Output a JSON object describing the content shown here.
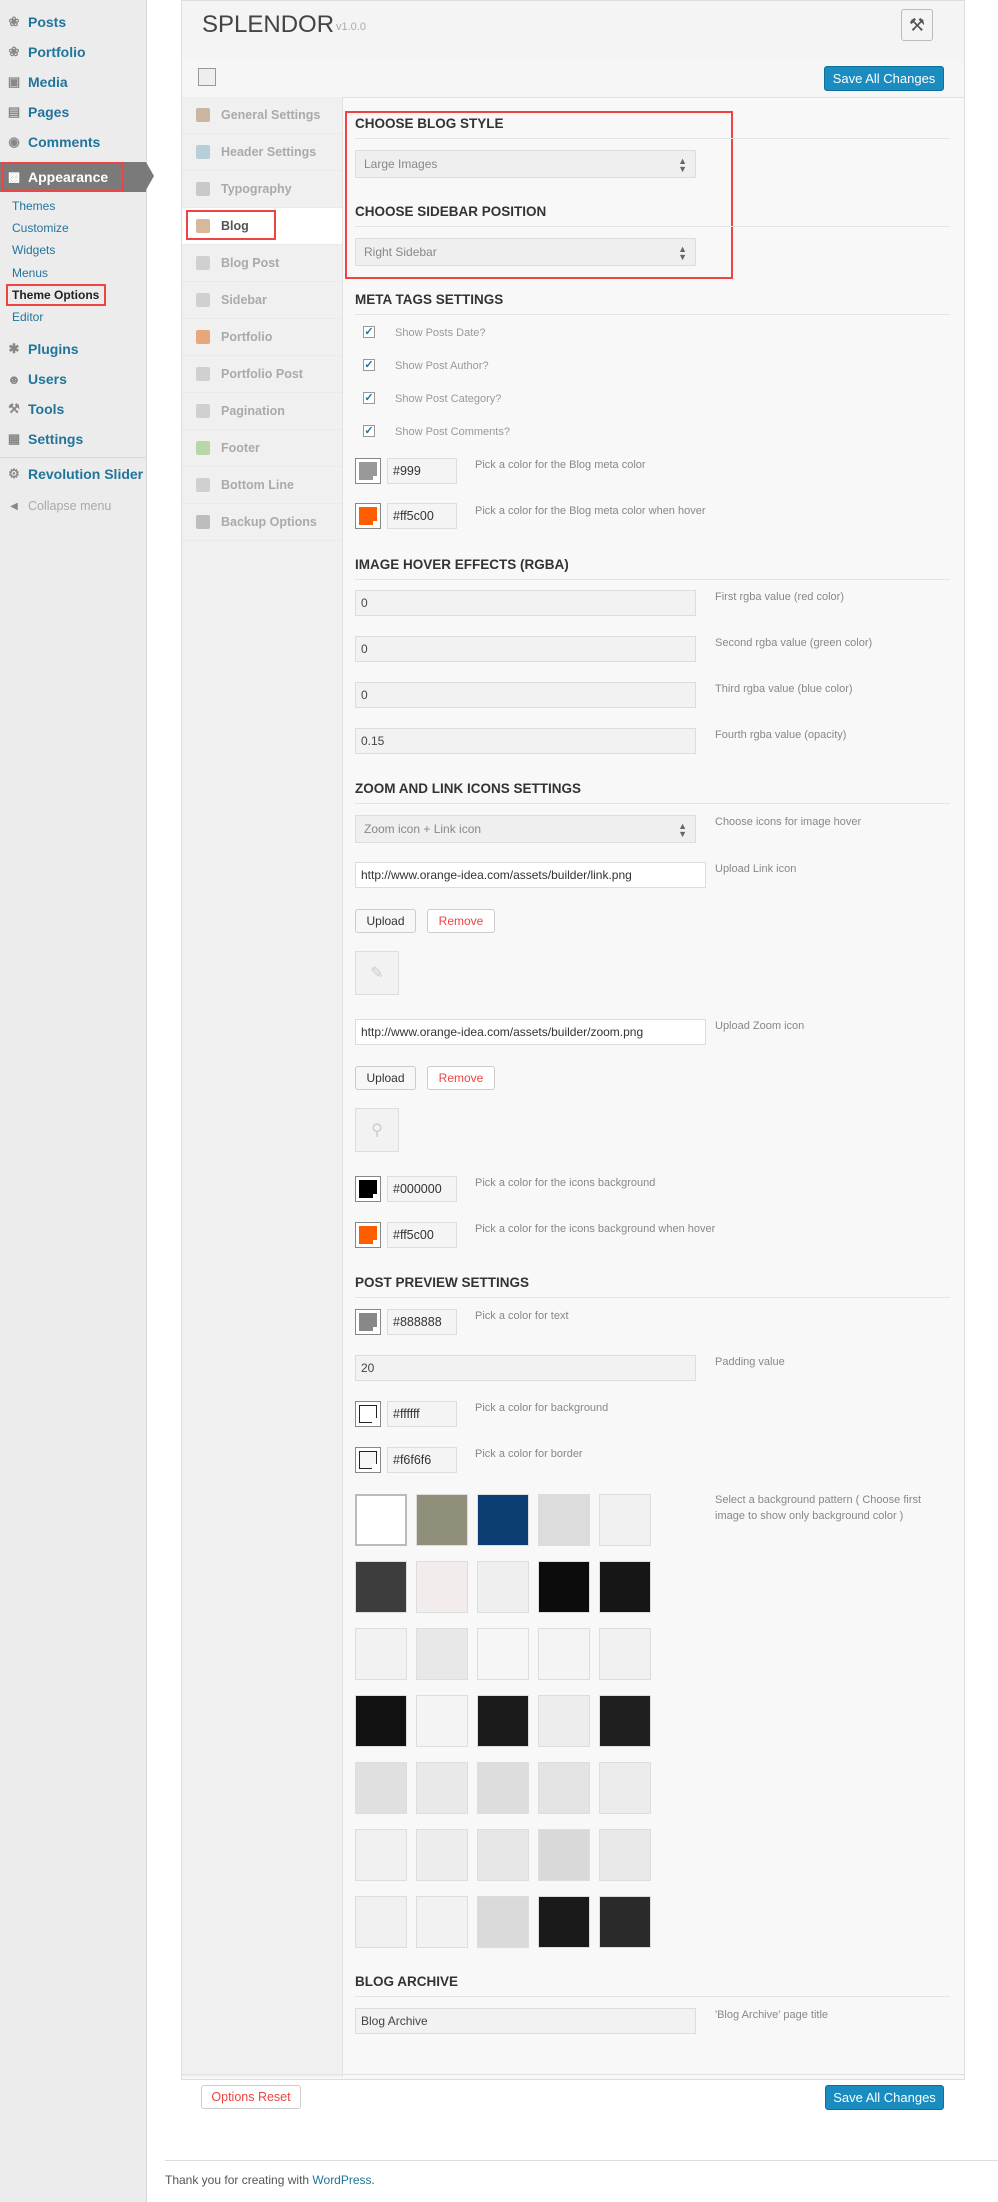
{
  "sidebar": {
    "items": [
      {
        "label": "Posts",
        "icon": "pushpin-icon"
      },
      {
        "label": "Portfolio",
        "icon": "pushpin-icon"
      },
      {
        "label": "Media",
        "icon": "media-icon"
      },
      {
        "label": "Pages",
        "icon": "pages-icon"
      },
      {
        "label": "Comments",
        "icon": "comments-icon"
      },
      {
        "label": "Appearance",
        "icon": "appearance-icon"
      }
    ],
    "submenu": [
      "Themes",
      "Customize",
      "Widgets",
      "Menus",
      "Theme Options",
      "Editor"
    ],
    "items2": [
      {
        "label": "Plugins",
        "icon": "plugins-icon"
      },
      {
        "label": "Users",
        "icon": "users-icon"
      },
      {
        "label": "Tools",
        "icon": "tools-icon"
      },
      {
        "label": "Settings",
        "icon": "settings-icon"
      }
    ],
    "revolution": "Revolution Slider",
    "collapse": "Collapse menu"
  },
  "header": {
    "title": "SPLENDOR",
    "version": "v1.0.0",
    "save_label": "Save All Changes"
  },
  "tabs": [
    {
      "label": "General Settings",
      "color": "#c9b6a0"
    },
    {
      "label": "Header Settings",
      "color": "#b8cfd9"
    },
    {
      "label": "Typography",
      "color": "#c9c9c9"
    },
    {
      "label": "Blog",
      "color": "#d8b89a"
    },
    {
      "label": "Blog Post",
      "color": "#d0d0d0"
    },
    {
      "label": "Sidebar",
      "color": "#d0d0d0"
    },
    {
      "label": "Portfolio",
      "color": "#e6a87a"
    },
    {
      "label": "Portfolio Post",
      "color": "#d0d0d0"
    },
    {
      "label": "Pagination",
      "color": "#d0d0d0"
    },
    {
      "label": "Footer",
      "color": "#b9d6a8"
    },
    {
      "label": "Bottom Line",
      "color": "#d0d0d0"
    },
    {
      "label": "Backup Options",
      "color": "#bdbdbd"
    }
  ],
  "blog_style": {
    "title": "CHOOSE BLOG STYLE",
    "value": "Large Images"
  },
  "sidebar_position": {
    "title": "CHOOSE SIDEBAR POSITION",
    "value": "Right Sidebar"
  },
  "meta": {
    "title": "META TAGS SETTINGS",
    "checks": [
      "Show Posts Date?",
      "Show Post Author?",
      "Show Post Category?",
      "Show Post Comments?"
    ],
    "colors": [
      {
        "value": "#999",
        "swatch": "#999999",
        "desc": "Pick a color for the Blog meta color"
      },
      {
        "value": "#ff5c00",
        "swatch": "#ff5c00",
        "desc": "Pick a color for the Blog meta color when hover"
      }
    ]
  },
  "hover": {
    "title": "IMAGE HOVER EFFECTS (RGBA)",
    "fields": [
      {
        "value": "0",
        "desc": "First rgba value (red color)"
      },
      {
        "value": "0",
        "desc": "Second rgba value (green color)"
      },
      {
        "value": "0",
        "desc": "Third rgba value (blue color)"
      },
      {
        "value": "0.15",
        "desc": "Fourth rgba value (opacity)"
      }
    ]
  },
  "zoom": {
    "title": "ZOOM AND LINK ICONS SETTINGS",
    "select_value": "Zoom icon + Link icon",
    "select_desc": "Choose icons for image hover",
    "link_url": "http://www.orange-idea.com/assets/builder/link.png",
    "link_desc": "Upload Link icon",
    "zoom_url": "http://www.orange-idea.com/assets/builder/zoom.png",
    "zoom_desc": "Upload Zoom icon",
    "upload_label": "Upload",
    "remove_label": "Remove",
    "colors": [
      {
        "value": "#000000",
        "swatch": "#000000",
        "desc": "Pick a color for the icons background"
      },
      {
        "value": "#ff5c00",
        "swatch": "#ff5c00",
        "desc": "Pick a color for the icons background when hover"
      }
    ]
  },
  "preview": {
    "title": "POST PREVIEW SETTINGS",
    "text_color": {
      "value": "#888888",
      "swatch": "#888888",
      "desc": "Pick a color for text"
    },
    "padding": {
      "value": "20",
      "desc": "Padding value"
    },
    "bg_color": {
      "value": "#ffffff",
      "swatch": "#ffffff",
      "desc": "Pick a color for background"
    },
    "border_color": {
      "value": "#f6f6f6",
      "swatch": "#f6f6f6",
      "desc": "Pick a color for border"
    },
    "pattern_desc": "Select a background pattern ( Choose first image to show only background color )",
    "patterns": [
      "#ffffff",
      "#8f8f7a",
      "#0d3e73",
      "#dcdcdc",
      "#f1f1f1",
      "#3d3d3d",
      "#f3ecec",
      "#efefef",
      "#0c0c0c",
      "#161616",
      "#f2f2f2",
      "#e8e8e8",
      "#f6f6f6",
      "#f4f4f4",
      "#f1f1f1",
      "#121212",
      "#f4f4f4",
      "#1b1b1b",
      "#ededed",
      "#1f1f1f",
      "#e0e0e0",
      "#e9e9e9",
      "#dddddd",
      "#e4e4e4",
      "#ececec",
      "#f0f0f0",
      "#ededed",
      "#e6e6e6",
      "#d9d9d9",
      "#e9e9e9",
      "#f0f0f0",
      "#f2f2f2",
      "#dadada",
      "#1a1a1a",
      "#2a2a2a"
    ]
  },
  "archive": {
    "title": "BLOG ARCHIVE",
    "value": "Blog Archive",
    "desc": "'Blog Archive' page title"
  },
  "footer": {
    "reset_label": "Options Reset",
    "save_label": "Save All Changes",
    "thanks": "Thank you for creating with ",
    "wp_link": "WordPress",
    "period": "."
  }
}
